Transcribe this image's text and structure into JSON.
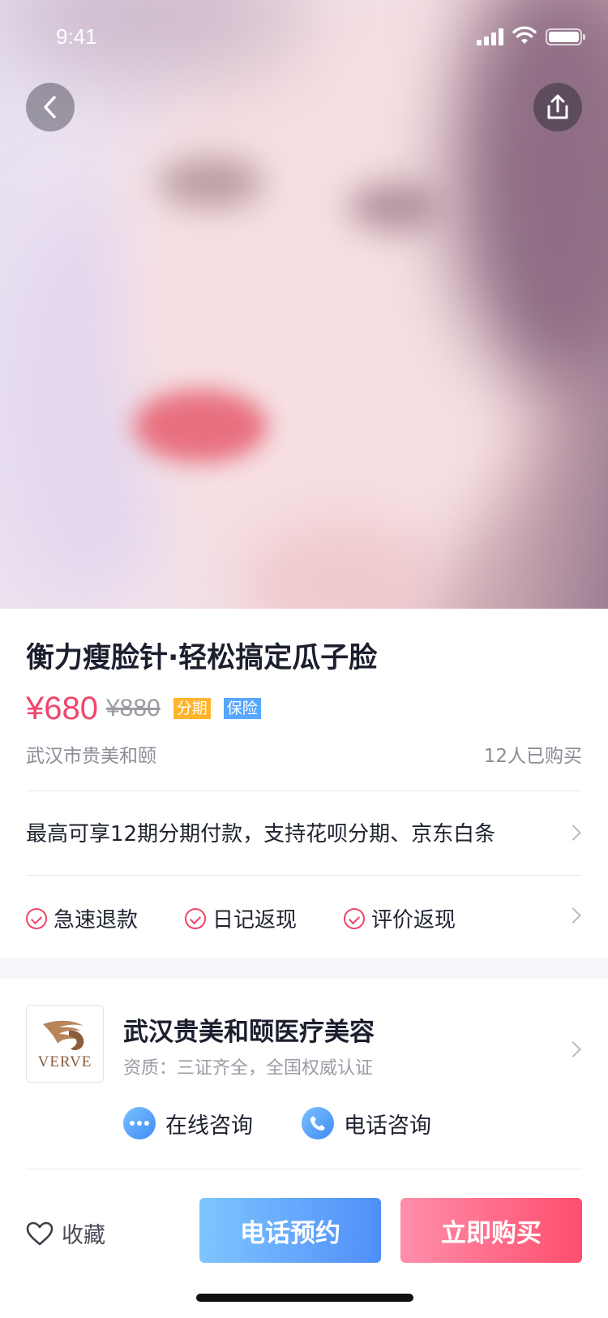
{
  "status_bar": {
    "time": "9:41"
  },
  "product": {
    "title": "衡力瘦脸针·轻松搞定瓜子脸",
    "price": "¥680",
    "original_price": "¥880",
    "tags": [
      "分期",
      "保险"
    ],
    "location": "武汉市贵美和颐",
    "buyers": "12人已购买"
  },
  "installment_text": "最高可享12期分期付款，支持花呗分期、京东白条",
  "guarantees": [
    "急速退款",
    "日记返现",
    "评价返现"
  ],
  "clinic": {
    "logo_text": "VERVE",
    "name": "武汉贵美和颐医疗美容",
    "qualification": "资质：三证齐全，全国权威认证",
    "online_consult": "在线咨询",
    "phone_consult": "电话咨询"
  },
  "bottom_bar": {
    "favorite": "收藏",
    "call_button": "电话预约",
    "buy_button": "立即购买"
  },
  "colors": {
    "accent_price": "#f2456a",
    "tag_installment": "#ffb42b",
    "tag_insurance": "#56a7ff"
  }
}
